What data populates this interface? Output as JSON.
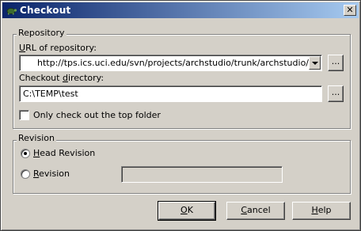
{
  "title": "Checkout",
  "repository": {
    "group_label": "Repository",
    "url_label_prefix": "",
    "url_label_accel": "U",
    "url_label_rest": "RL of repository:",
    "url_value": "http://tps.ics.uci.edu/svn/projects/archstudio/trunk/archstudio/",
    "browse_url_label": "...",
    "dir_label_prefix": "Checkout ",
    "dir_label_accel": "d",
    "dir_label_rest": "irectory:",
    "dir_value": "C:\\TEMP\\test",
    "browse_dir_label": "...",
    "top_folder_label": "Only check out the top folder"
  },
  "revision": {
    "group_label": "Revision",
    "head_accel": "H",
    "head_rest": "ead Revision",
    "rev_accel": "R",
    "rev_rest": "evision",
    "rev_value": ""
  },
  "buttons": {
    "ok_accel": "O",
    "ok_rest": "K",
    "cancel_accel": "C",
    "cancel_rest": "ancel",
    "help_accel": "H",
    "help_rest": "elp"
  },
  "icons": {
    "app": "tortoise-icon",
    "close": "close-icon"
  }
}
